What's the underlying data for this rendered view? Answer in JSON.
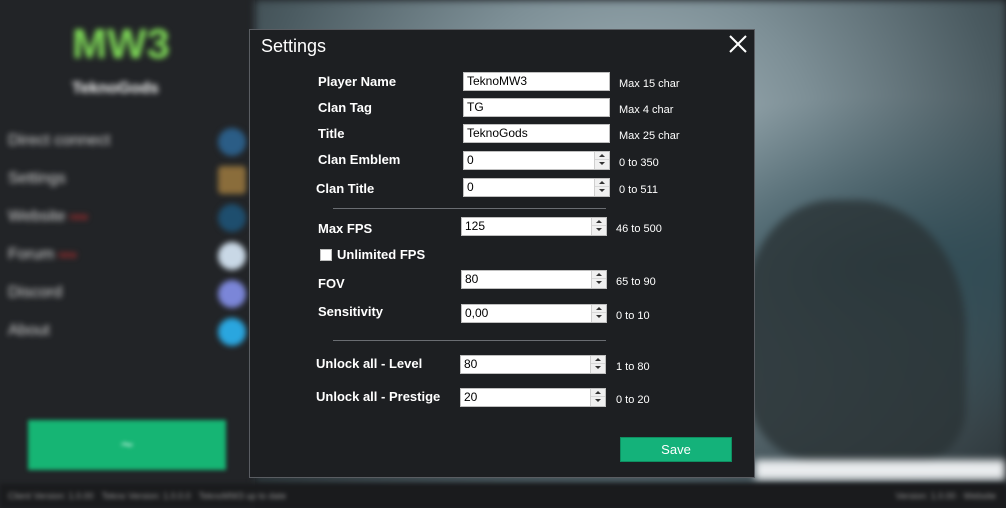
{
  "launcher": {
    "username": "TeknoGods",
    "menu": [
      {
        "label": "Direct connect",
        "tag": ""
      },
      {
        "label": "Settings",
        "tag": ""
      },
      {
        "label": "Website",
        "tag": "new"
      },
      {
        "label": "Forum",
        "tag": "new"
      },
      {
        "label": "Discord",
        "tag": ""
      },
      {
        "label": "About",
        "tag": ""
      }
    ],
    "play_label": "~",
    "status_left_1": "Client Version: 1.0.00",
    "status_left_2": "Tekno Version: 1.0.0.0",
    "status_left_3": "TeknoMW3 up to date",
    "status_right": "Version: 1.0.00 · Website"
  },
  "dialog": {
    "title": "Settings",
    "player_name": {
      "label": "Player Name",
      "value": "TeknoMW3",
      "hint": "Max 15 char"
    },
    "clan_tag": {
      "label": "Clan Tag",
      "value": "TG",
      "hint": "Max 4 char"
    },
    "title_field": {
      "label": "Title",
      "value": "TeknoGods",
      "hint": "Max 25 char"
    },
    "clan_emblem": {
      "label": "Clan Emblem",
      "value": "0",
      "hint": "0 to 350"
    },
    "clan_title": {
      "label": "Clan Title",
      "value": "0",
      "hint": "0 to 511"
    },
    "max_fps": {
      "label": "Max FPS",
      "value": "125",
      "hint": "46 to 500"
    },
    "unlimited_fps": {
      "label": "Unlimited FPS",
      "checked": false
    },
    "fov": {
      "label": "FOV",
      "value": "80",
      "hint": "65 to 90"
    },
    "sensitivity": {
      "label": "Sensitivity",
      "value": "0,00",
      "hint": "0 to 10"
    },
    "unlock_level": {
      "label": "Unlock all - Level",
      "value": "80",
      "hint": "1 to 80"
    },
    "unlock_prestige": {
      "label": "Unlock all - Prestige",
      "value": "20",
      "hint": "0 to 20"
    },
    "save_label": "Save"
  },
  "colors": {
    "accent": "#14b27a",
    "dialog_bg": "#1d1f22",
    "sidebar_bg": "#222427"
  },
  "icons": [
    "close-icon",
    "spin-up-icon",
    "spin-down-icon",
    "mw3-logo"
  ]
}
